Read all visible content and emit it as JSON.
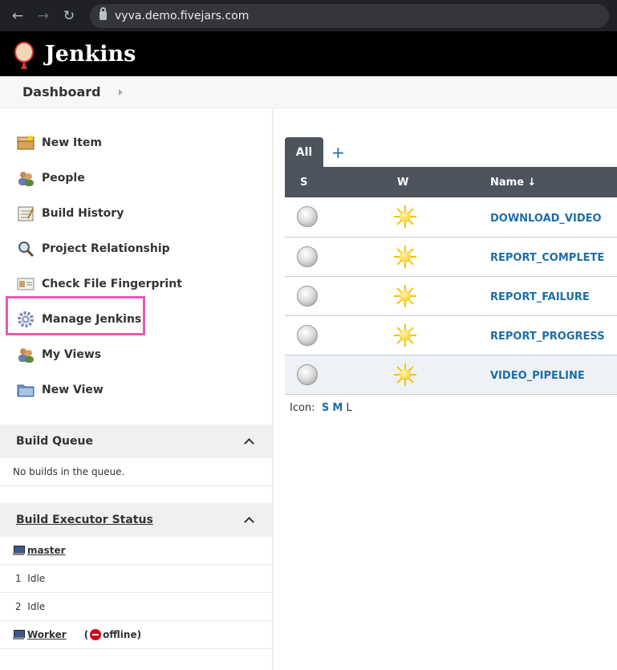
{
  "browser": {
    "url": "vyva.demo.fivejars.com"
  },
  "header": {
    "title": "Jenkins"
  },
  "breadcrumb": {
    "item": "Dashboard"
  },
  "sidebar": {
    "tasks": [
      {
        "label": "New Item",
        "icon": "new-item-icon"
      },
      {
        "label": "People",
        "icon": "people-icon"
      },
      {
        "label": "Build History",
        "icon": "build-history-icon"
      },
      {
        "label": "Project Relationship",
        "icon": "magnifier-icon"
      },
      {
        "label": "Check File Fingerprint",
        "icon": "fingerprint-icon"
      },
      {
        "label": "Manage Jenkins",
        "icon": "gear-icon"
      },
      {
        "label": "My Views",
        "icon": "people-icon"
      },
      {
        "label": "New View",
        "icon": "folder-icon"
      }
    ],
    "build_queue": {
      "title": "Build Queue",
      "empty": "No builds in the queue."
    },
    "executors": {
      "title": "Build Executor Status",
      "master": "master",
      "slots": [
        {
          "num": "1",
          "state": "Idle"
        },
        {
          "num": "2",
          "state": "Idle"
        }
      ],
      "worker": "Worker",
      "worker_status_open": "(",
      "worker_status": "offline)"
    }
  },
  "main": {
    "tab_all": "All",
    "tab_add": "+",
    "columns": {
      "s": "S",
      "w": "W",
      "name": "Name ↓"
    },
    "jobs": [
      {
        "name": "DOWNLOAD_VIDEO"
      },
      {
        "name": "REPORT_COMPLETE"
      },
      {
        "name": "REPORT_FAILURE"
      },
      {
        "name": "REPORT_PROGRESS"
      },
      {
        "name": "VIDEO_PIPELINE"
      }
    ],
    "icon_label": "Icon:",
    "icon_sizes": [
      "S",
      "M",
      "L"
    ]
  },
  "colors": {
    "header_bg": "#000000",
    "highlight": "#e35bb7",
    "link": "#1d6ea8",
    "table_head": "#4d545d"
  }
}
